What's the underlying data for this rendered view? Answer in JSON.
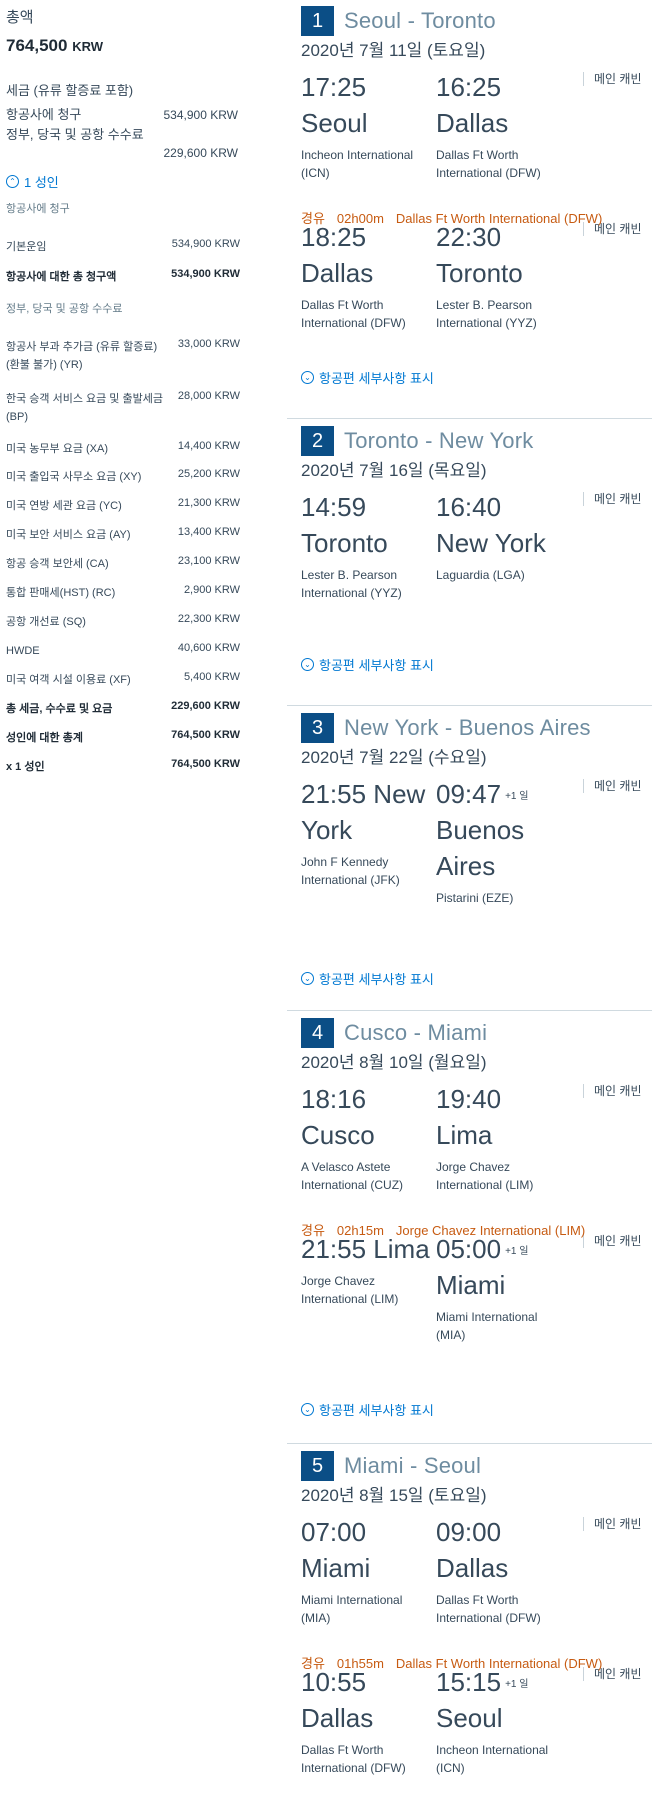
{
  "summary": {
    "total_label": "총액",
    "total_amount": "764,500",
    "total_currency": "KRW",
    "tax_title": "세금 (유류 할증료 포함)",
    "airline_charge_label": "항공사에 청구",
    "airline_charge_amount": "534,900 KRW",
    "gov_fees_label": "정부, 당국 및 공항 수수료",
    "gov_fees_amount": "229,600 KRW",
    "passenger_toggle": "1 성인",
    "airline_billed_sub": "항공사에 청구",
    "base_fare_label": "기본운임",
    "base_fare_amount": "534,900 KRW",
    "airline_total_label": "항공사에 대한 총 청구액",
    "airline_total_amount": "534,900 KRW",
    "gov_sub": "정부, 당국 및 공항 수수료",
    "fees": [
      {
        "label": "항공사 부과 추가금 (유류 할증료) (환불 불가) (YR)",
        "amount": "33,000 KRW"
      },
      {
        "label": "한국 승객 서비스 요금 및 출발세금 (BP)",
        "amount": "28,000 KRW"
      },
      {
        "label": "미국 농무부 요금 (XA)",
        "amount": "14,400 KRW"
      },
      {
        "label": "미국 출입국 사무소 요금 (XY)",
        "amount": "25,200 KRW"
      },
      {
        "label": "미국 연방 세관 요금 (YC)",
        "amount": "21,300 KRW"
      },
      {
        "label": "미국 보안 서비스 요금 (AY)",
        "amount": "13,400 KRW"
      },
      {
        "label": "항공 승객 보안세 (CA)",
        "amount": "23,100 KRW"
      },
      {
        "label": "통합 판매세(HST) (RC)",
        "amount": "2,900 KRW"
      },
      {
        "label": "공항 개선료 (SQ)",
        "amount": "22,300 KRW"
      },
      {
        "label": "HWDE",
        "amount": "40,600 KRW"
      },
      {
        "label": "미국 여객 시설 이용료 (XF)",
        "amount": "5,400 KRW"
      }
    ],
    "totals": [
      {
        "label": "총 세금, 수수료 및 요금",
        "amount": "229,600 KRW"
      },
      {
        "label": "성인에 대한 총계",
        "amount": "764,500 KRW"
      },
      {
        "label": "x 1 성인",
        "amount": "764,500 KRW"
      }
    ]
  },
  "common": {
    "cabin": "메인 캐빈",
    "layover_label": "경유",
    "details_link": "항공편 세부사항 표시",
    "plus_day": "+1 일"
  },
  "slices": [
    {
      "number": "1",
      "route": "Seoul - Toronto",
      "date": "2020년 7월 11일 (토요일)",
      "segments": [
        {
          "dep_time": "17:25",
          "arr_time": "16:25",
          "dep_city": "Seoul",
          "arr_city": "Dallas",
          "dep_airport": "Incheon International (ICN)",
          "arr_airport": "Dallas Ft Worth International (DFW)"
        },
        {
          "dep_time": "18:25",
          "arr_time": "22:30",
          "dep_city": "Dallas",
          "arr_city": "Toronto",
          "dep_airport": "Dallas Ft Worth International (DFW)",
          "arr_airport": "Lester B. Pearson International (YYZ)"
        }
      ],
      "layovers": [
        {
          "duration": "02h00m",
          "airport": "Dallas Ft Worth International (DFW)"
        }
      ]
    },
    {
      "number": "2",
      "route": "Toronto - New York",
      "date": "2020년 7월 16일 (목요일)",
      "segments": [
        {
          "dep_time": "14:59",
          "arr_time": "16:40",
          "dep_city": "Toronto",
          "arr_city": "New York",
          "dep_airport": "Lester B. Pearson International (YYZ)",
          "arr_airport": "Laguardia (LGA)"
        }
      ]
    },
    {
      "number": "3",
      "route": "New York - Buenos Aires",
      "date": "2020년 7월 22일 (수요일)",
      "segments": [
        {
          "dep_time": "21:55",
          "arr_time": "09:47",
          "dep_city": "New York",
          "arr_city": "Buenos Aires",
          "dep_airport": "John F Kennedy International (JFK)",
          "arr_airport": "Pistarini (EZE)"
        }
      ]
    },
    {
      "number": "4",
      "route": "Cusco - Miami",
      "date": "2020년 8월 10일 (월요일)",
      "segments": [
        {
          "dep_time": "18:16",
          "arr_time": "19:40",
          "dep_city": "Cusco",
          "arr_city": "Lima",
          "dep_airport": "A Velasco Astete International (CUZ)",
          "arr_airport": "Jorge Chavez International (LIM)"
        },
        {
          "dep_time": "21:55",
          "arr_time": "05:00",
          "dep_city": "Lima",
          "arr_city": "Miami",
          "dep_airport": "Jorge Chavez International (LIM)",
          "arr_airport": "Miami International (MIA)"
        }
      ],
      "layovers": [
        {
          "duration": "02h15m",
          "airport": "Jorge Chavez International (LIM)"
        }
      ]
    },
    {
      "number": "5",
      "route": "Miami - Seoul",
      "date": "2020년 8월 15일 (토요일)",
      "segments": [
        {
          "dep_time": "07:00",
          "arr_time": "09:00",
          "dep_city": "Miami",
          "arr_city": "Dallas",
          "dep_airport": "Miami International (MIA)",
          "arr_airport": "Dallas Ft Worth International (DFW)"
        },
        {
          "dep_time": "10:55",
          "arr_time": "15:15",
          "dep_city": "Dallas",
          "arr_city": "Seoul",
          "dep_airport": "Dallas Ft Worth International (DFW)",
          "arr_airport": "Incheon International (ICN)"
        }
      ],
      "layovers": [
        {
          "duration": "01h55m",
          "airport": "Dallas Ft Worth International (DFW)"
        }
      ]
    }
  ]
}
